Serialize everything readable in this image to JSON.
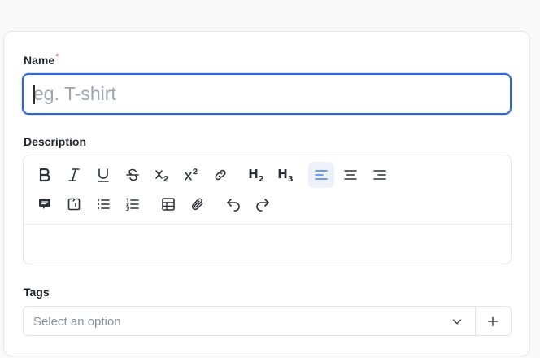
{
  "form": {
    "name_label": "Name",
    "required_mark": "*",
    "name_placeholder": "eg. T-shirt",
    "name_value": "",
    "description_label": "Description",
    "tags_label": "Tags",
    "tags_placeholder": "Select an option"
  },
  "toolbar": {
    "row1": [
      "bold",
      "italic",
      "underline",
      "strikethrough",
      "subscript",
      "superscript",
      "link",
      "heading-2",
      "heading-3",
      "align-left",
      "align-center",
      "align-right"
    ],
    "row2": [
      "comment",
      "note",
      "bullet-list",
      "numbered-list",
      "table",
      "attachment",
      "undo",
      "redo"
    ],
    "active": "align-left",
    "heading2_text": "H",
    "heading2_sub": "2",
    "heading3_text": "H",
    "heading3_sub": "3"
  },
  "colors": {
    "accent": "#2f63d8",
    "required": "#e5484d",
    "active_icon": "#3b82f6"
  }
}
